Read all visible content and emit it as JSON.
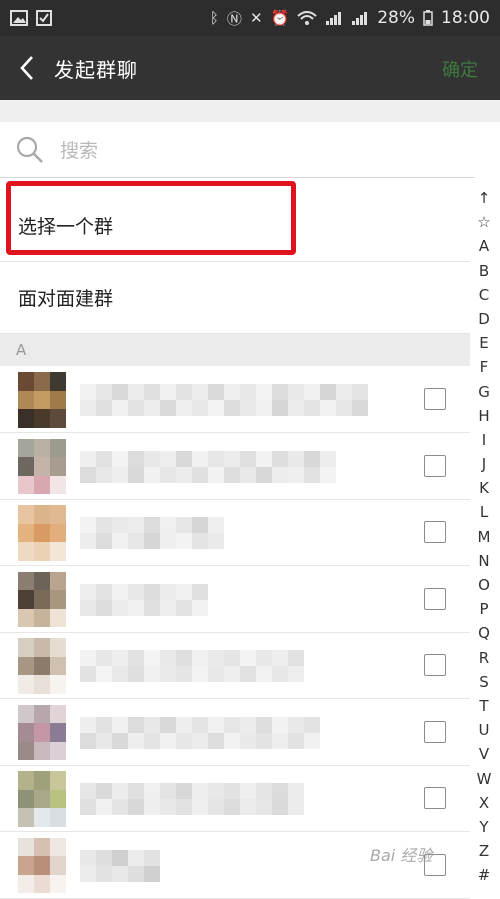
{
  "status_bar": {
    "time": "18:00",
    "battery": "28%",
    "left_icons": [
      "image-icon",
      "checkbox-icon"
    ],
    "right_icons": [
      "bluetooth-icon",
      "nfc-icon",
      "mute-icon",
      "alarm-icon",
      "wifi-icon",
      "signal-icon",
      "signal-icon",
      "battery-icon"
    ]
  },
  "toolbar": {
    "back_icon": "chevron-left-icon",
    "title": "发起群聊",
    "confirm_label": "确定",
    "confirm_color": "#3d7a3d"
  },
  "search": {
    "icon": "search-icon",
    "placeholder": "搜索"
  },
  "options": [
    {
      "label": "选择一个群"
    },
    {
      "label": "面对面建群"
    }
  ],
  "highlight_color": "#e0141e",
  "section_letter": "A",
  "contacts": [
    {
      "checked": false
    },
    {
      "checked": false
    },
    {
      "checked": false
    },
    {
      "checked": false
    },
    {
      "checked": false
    },
    {
      "checked": false
    },
    {
      "checked": false
    },
    {
      "checked": false
    }
  ],
  "index_letters": [
    "↑",
    "☆",
    "A",
    "B",
    "C",
    "D",
    "E",
    "F",
    "G",
    "H",
    "I",
    "J",
    "K",
    "L",
    "M",
    "N",
    "O",
    "P",
    "Q",
    "R",
    "S",
    "T",
    "U",
    "V",
    "W",
    "X",
    "Y",
    "Z",
    "#"
  ],
  "watermark": "Bai 经验"
}
